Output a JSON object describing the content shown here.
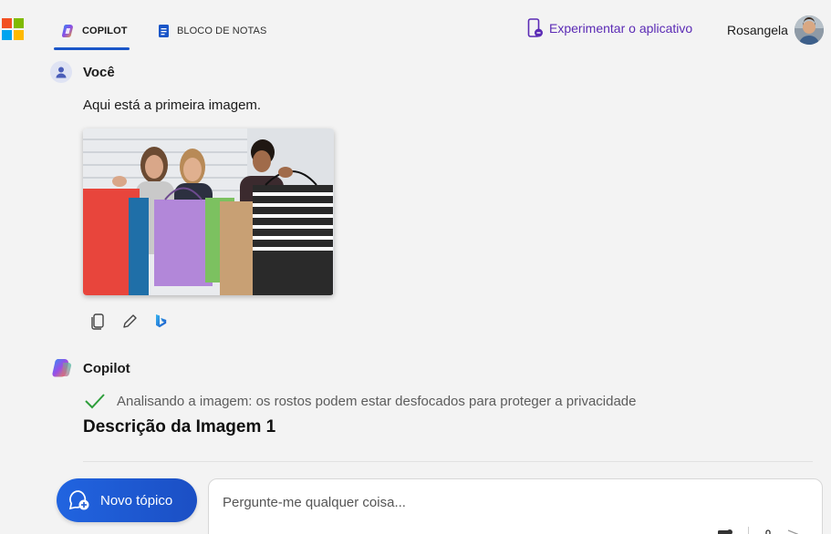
{
  "header": {
    "tabs": [
      {
        "label": "COPILOT",
        "active": true
      },
      {
        "label": "BLOCO DE NOTAS",
        "active": false
      }
    ],
    "try_app_label": "Experimentar o aplicativo",
    "user_name": "Rosangela"
  },
  "chat": {
    "user_message": {
      "author": "Você",
      "text": "Aqui está a primeira imagem."
    },
    "copilot_message": {
      "author": "Copilot",
      "status_text": "Analisando a imagem: os rostos podem estar desfocados para proteger a privacidade",
      "heading": "Descrição da Imagem 1"
    }
  },
  "composer": {
    "new_topic_label": "Novo tópico",
    "placeholder": "Pergunte-me qualquer coisa..."
  },
  "colors": {
    "accent": "#1a56c8",
    "try_app": "#5b2bb5",
    "status_check": "#2e9e3b"
  }
}
